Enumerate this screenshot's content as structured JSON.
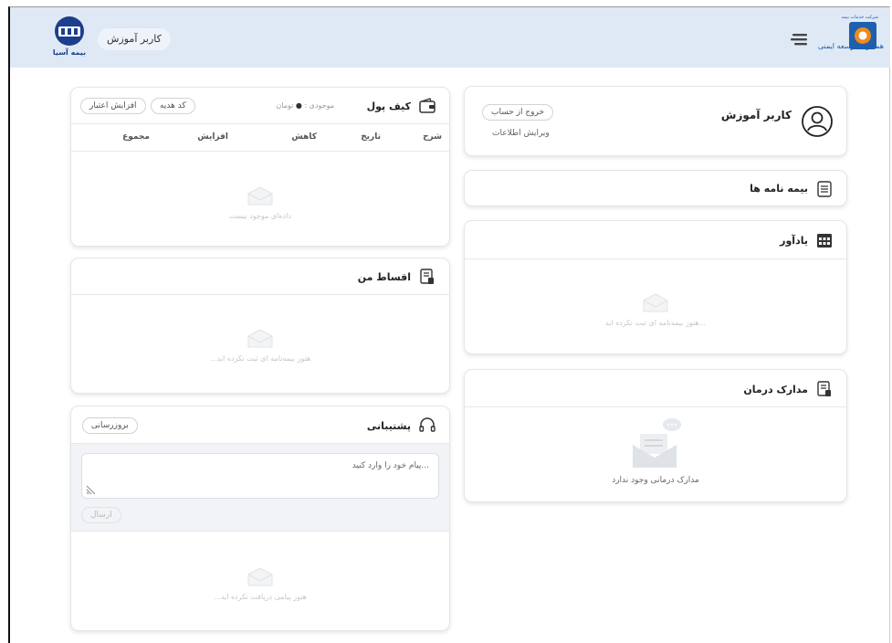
{
  "header": {
    "user_label": "کاربر آموزش",
    "brand_left": "بیمه آسیا",
    "brand_right": "همکاران توسعه ایمنی",
    "brand_right_top": "شرکت خدمات بیمه"
  },
  "wallet": {
    "title": "کیف پول",
    "balance_label": "موجودی :",
    "balance_value": "●",
    "currency": "تومان",
    "gift_code_button": "کد هدیه",
    "add_credit_button": "افزایش اعتبار",
    "columns": [
      "شرح",
      "تاریخ",
      "کاهش",
      "افزایش",
      "مجموع"
    ],
    "empty_text": "داده‌ای موجود نیست"
  },
  "installments": {
    "title": "اقساط من",
    "empty_text": "...هنوز بیمه‌نامه ای ثبت نکرده اید"
  },
  "support": {
    "title": "پشتیبانی",
    "refresh_button": "بروزرسانی",
    "message_placeholder": "پیام خود را وارد کنید...",
    "send_button": "ارسال",
    "empty_text": "...هنوز پیامی دریافت نکرده اید"
  },
  "profile": {
    "name": "کاربر آموزش",
    "logout_button": "خروج از حساب",
    "edit_link": "ویرایش اطلاعات"
  },
  "policies": {
    "title": "بیمه نامه ها"
  },
  "reminder": {
    "title": "یادآور",
    "empty_text": "هنوز بیمه‌نامه ای ثبت نکرده اید..."
  },
  "medical_docs": {
    "title": "مدارک درمان",
    "empty_text": "مدارک درمانی وجود ندارد"
  },
  "icons": {
    "menu": "hamburger-icon",
    "wallet": "wallet-icon",
    "installments": "document-icon",
    "support": "headset-icon",
    "profile": "user-icon",
    "policies": "list-icon",
    "reminder": "calendar-icon",
    "medical": "document-icon"
  },
  "colors": {
    "header_bg": "#dfe9f5",
    "brand_blue": "#1c3e8c",
    "brand_orange": "#f08a1c"
  }
}
